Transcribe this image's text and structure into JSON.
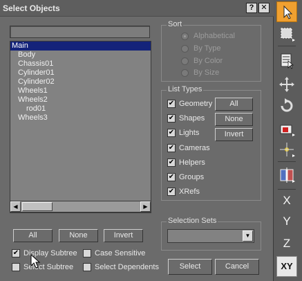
{
  "dialog": {
    "title": "Select Objects",
    "help_button": "?",
    "close_button": "✕"
  },
  "search": {
    "value": ""
  },
  "object_list": {
    "items": [
      {
        "label": "Main",
        "selected": true
      },
      {
        "label": "Body"
      },
      {
        "label": "Chassis01"
      },
      {
        "label": "Cylinder01"
      },
      {
        "label": "Cylinder02"
      },
      {
        "label": "Wheels1"
      },
      {
        "label": "Wheels2"
      },
      {
        "label": "rod01"
      },
      {
        "label": "Wheels3"
      }
    ]
  },
  "sort": {
    "label": "Sort",
    "options": [
      "Alphabetical",
      "By Type",
      "By Color",
      "By Size"
    ],
    "selected": "Alphabetical"
  },
  "list_types": {
    "label": "List Types",
    "items": [
      "Geometry",
      "Shapes",
      "Lights",
      "Cameras",
      "Helpers",
      "Groups",
      "XRefs"
    ],
    "all_button": "All",
    "none_button": "None",
    "invert_button": "Invert"
  },
  "bottom_buttons": {
    "all": "All",
    "none": "None",
    "invert": "Invert"
  },
  "options": {
    "display_subtree": "Display Subtree",
    "case_sensitive": "Case Sensitive",
    "select_subtree": "Select Subtree",
    "select_dependents": "Select Dependents"
  },
  "selection_sets": {
    "label": "Selection Sets",
    "value": ""
  },
  "actions": {
    "select": "Select",
    "cancel": "Cancel"
  },
  "toolbar": {
    "x": "X",
    "y": "Y",
    "z": "Z",
    "xy": "XY"
  }
}
